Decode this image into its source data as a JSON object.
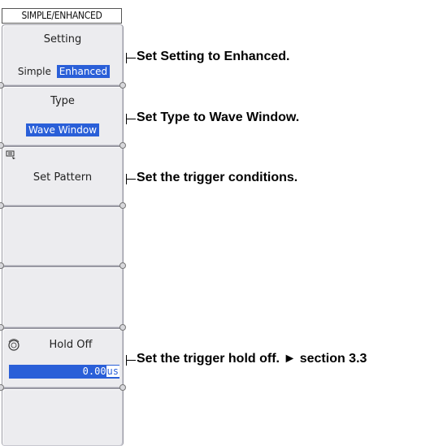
{
  "menu": {
    "header": "SIMPLE/ENHANCED",
    "keys": [
      {
        "title": "Setting",
        "options": [
          "Simple",
          "Enhanced"
        ],
        "selected": "Enhanced"
      },
      {
        "title": "Type",
        "value": "Wave Window"
      },
      {
        "title": "Set Pattern",
        "icon": "pattern-icon"
      },
      {
        "title": ""
      },
      {
        "title": ""
      },
      {
        "title": "Hold Off",
        "icon": "knob-icon",
        "value": "0.00",
        "unit": "us"
      },
      {
        "title": ""
      }
    ]
  },
  "annotations": [
    "Set Setting to Enhanced.",
    "Set Type to Wave Window.",
    "Set the trigger conditions.",
    "Set the trigger hold off. ► section 3.3"
  ],
  "colors": {
    "highlight": "#2a5fd8",
    "key_bg": "#ececef"
  }
}
